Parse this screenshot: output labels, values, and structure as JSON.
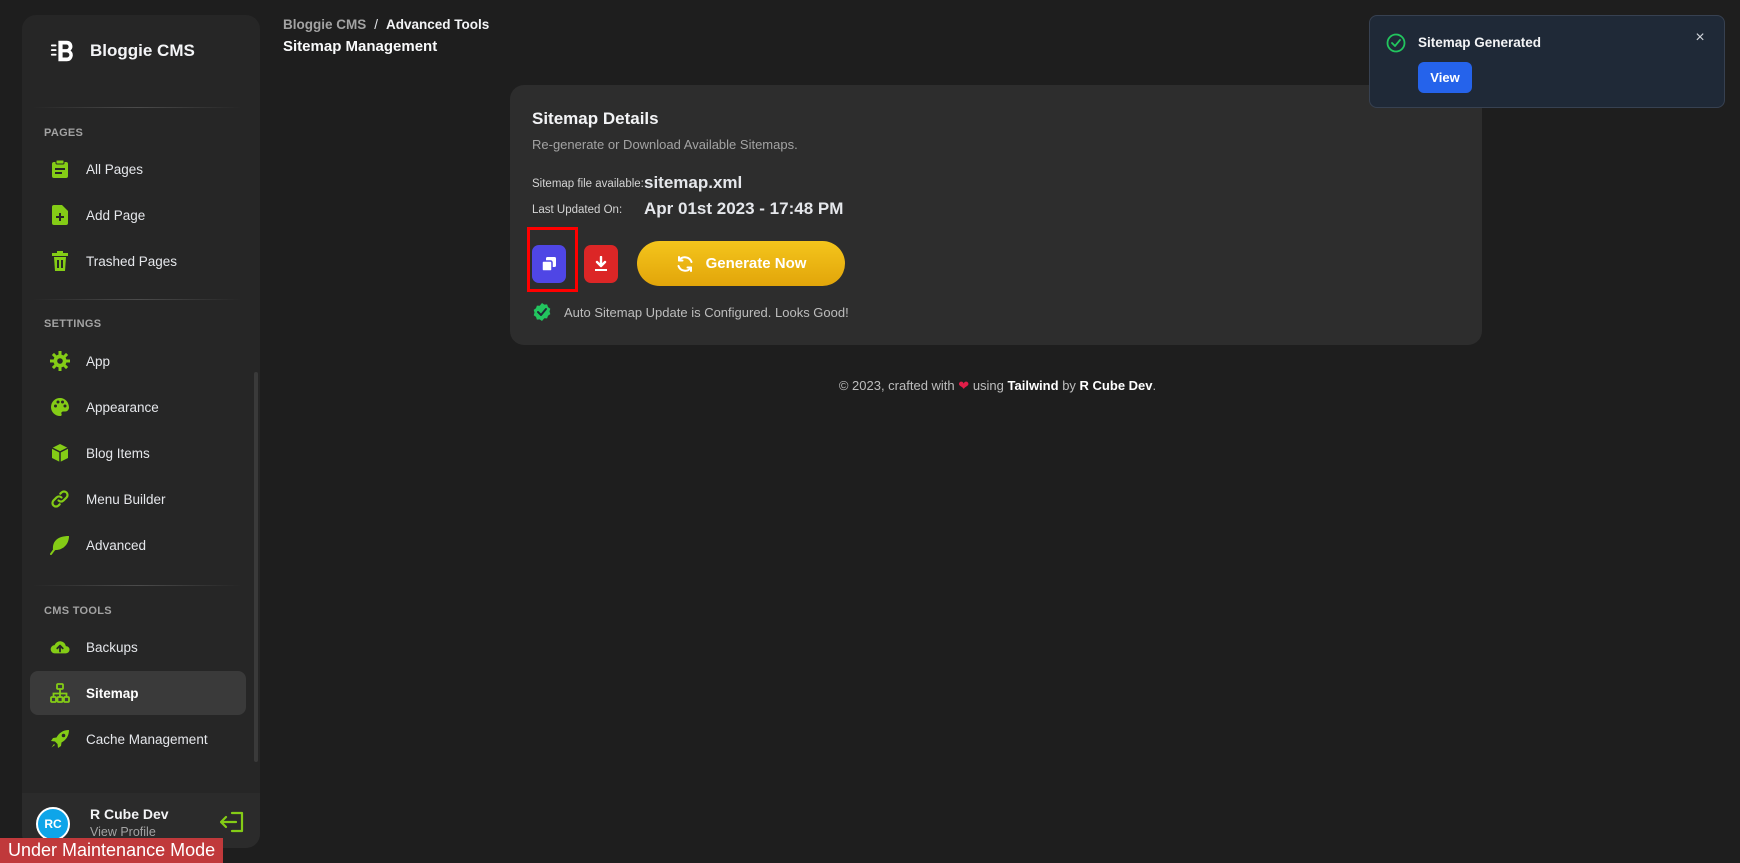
{
  "brand": {
    "name": "Bloggie CMS"
  },
  "sidebar": {
    "sections": [
      {
        "title": "PAGES",
        "items": [
          {
            "label": "All Pages",
            "icon": "clipboard-icon"
          },
          {
            "label": "Add Page",
            "icon": "file-plus-icon"
          },
          {
            "label": "Trashed Pages",
            "icon": "trash-icon"
          }
        ]
      },
      {
        "title": "SETTINGS",
        "items": [
          {
            "label": "App",
            "icon": "gear-icon"
          },
          {
            "label": "Appearance",
            "icon": "palette-icon"
          },
          {
            "label": "Blog Items",
            "icon": "cube-icon"
          },
          {
            "label": "Menu Builder",
            "icon": "link-icon"
          },
          {
            "label": "Advanced",
            "icon": "leaf-icon"
          }
        ]
      },
      {
        "title": "CMS TOOLS",
        "items": [
          {
            "label": "Backups",
            "icon": "cloud-upload-icon"
          },
          {
            "label": "Sitemap",
            "icon": "sitemap-icon",
            "active": true
          },
          {
            "label": "Cache Management",
            "icon": "rocket-icon"
          }
        ]
      }
    ],
    "accent_color": "#84cc16"
  },
  "profile": {
    "initials": "RC",
    "name": "R Cube Dev",
    "link": "View Profile"
  },
  "maintenance": {
    "label": "Under Maintenance Mode"
  },
  "header": {
    "breadcrumb_root": "Bloggie CMS",
    "breadcrumb_sep": "/",
    "breadcrumb_current": "Advanced Tools",
    "title": "Sitemap Management"
  },
  "card": {
    "title": "Sitemap Details",
    "subtitle": "Re-generate or Download Available Sitemaps.",
    "file_label": "Sitemap file available:",
    "file_value": "sitemap.xml",
    "updated_label": "Last Updated On:",
    "updated_value": "Apr 01st 2023 - 17:48 PM",
    "generate_label": "Generate Now",
    "status_text": "Auto Sitemap Update is Configured. Looks Good!"
  },
  "footer": {
    "prefix": "© 2023, crafted with",
    "using": "using",
    "tailwind": "Tailwind",
    "by": "by",
    "author": "R Cube Dev",
    "suffix": "."
  },
  "toast": {
    "title": "Sitemap Generated",
    "view_label": "View",
    "close": "×"
  },
  "colors": {
    "copy_button": "#4f46e5",
    "download_button": "#dc2626",
    "generate_button": "#eab308",
    "toast_button": "#2563eb",
    "success": "#22c55e"
  }
}
